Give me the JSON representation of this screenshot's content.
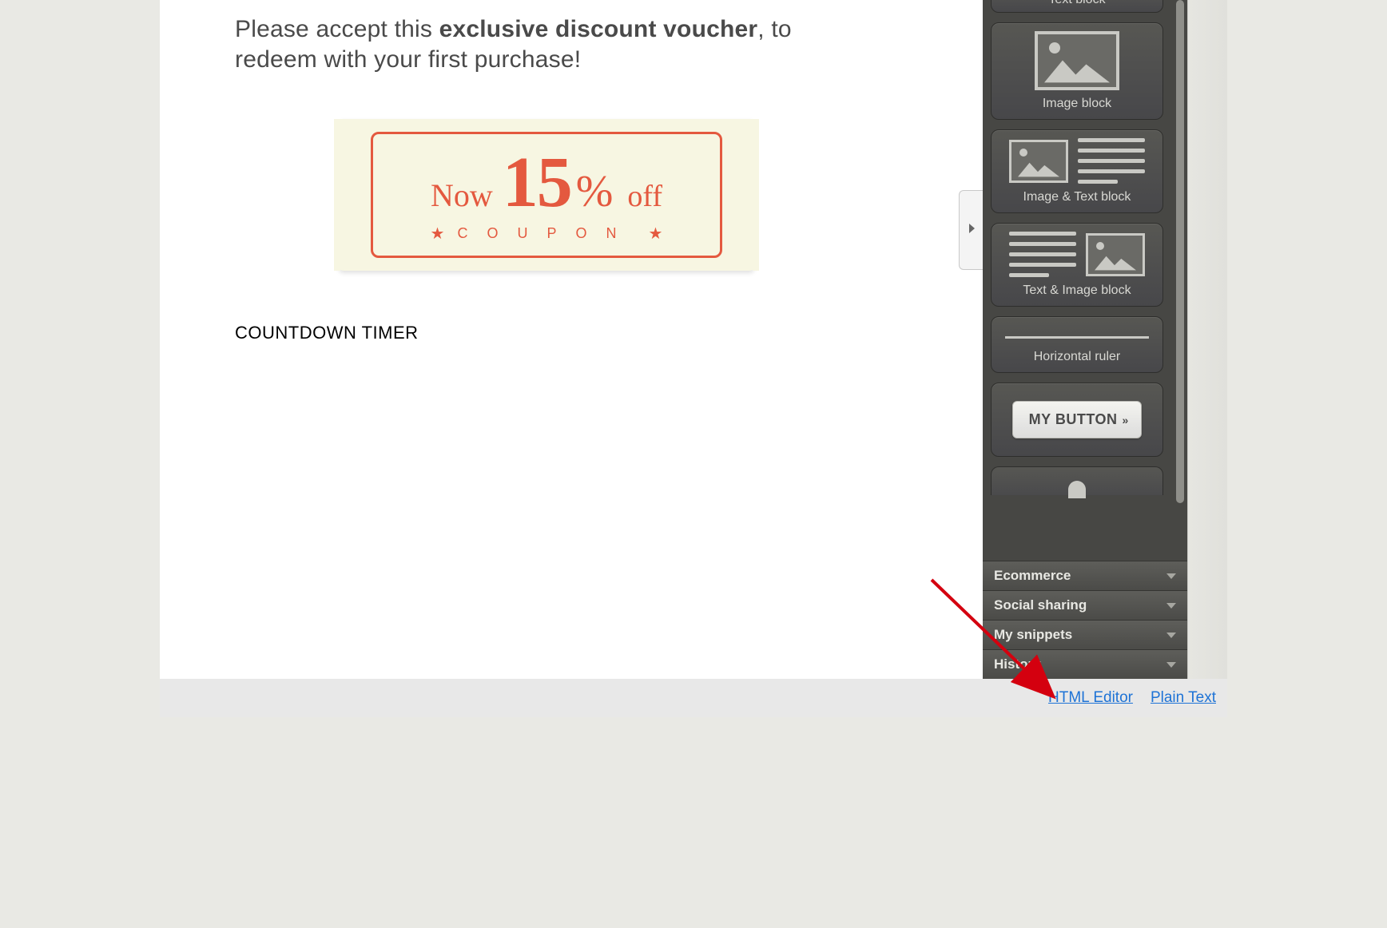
{
  "content": {
    "intro_pre": "Please accept this ",
    "intro_bold": "exclusive discount voucher",
    "intro_post": ", to redeem with your first purchase!",
    "coupon": {
      "now": "Now",
      "amount": "15",
      "percent": "%",
      "off": "off",
      "label": "COUPON"
    },
    "timer_label": "COUNTDOWN TIMER"
  },
  "sidebar": {
    "tiles": {
      "text_block": "Text block",
      "image_block": "Image block",
      "image_text_block": "Image & Text block",
      "text_image_block": "Text & Image block",
      "hr": "Horizontal ruler",
      "button_label": "MY BUTTON"
    },
    "accordion": {
      "ecommerce": "Ecommerce",
      "social": "Social sharing",
      "snippets": "My snippets",
      "history": "History"
    }
  },
  "footer": {
    "html_editor": "HTML Editor",
    "plain_text": "Plain Text"
  }
}
